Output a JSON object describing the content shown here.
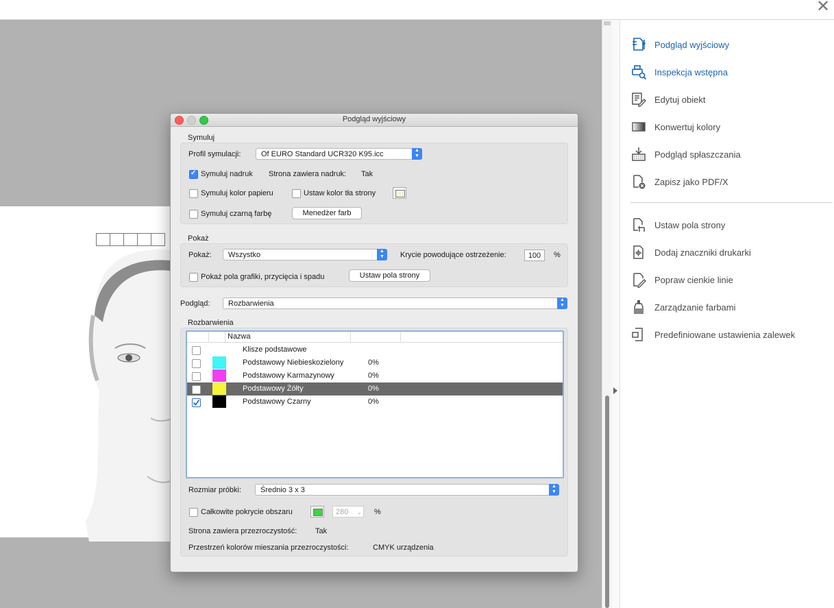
{
  "window": {
    "close_glyph": "✕"
  },
  "right_panel": {
    "items_top": [
      {
        "label": "Podgląd wyjściowy",
        "icon": "output-preview-icon",
        "active": true
      },
      {
        "label": "Inspekcja wstępna",
        "icon": "preflight-icon",
        "active": true
      },
      {
        "label": "Edytuj obiekt",
        "icon": "edit-object-icon",
        "active": false
      },
      {
        "label": "Konwertuj kolory",
        "icon": "convert-colors-icon",
        "active": false
      },
      {
        "label": "Podgląd spłaszczania",
        "icon": "flattener-preview-icon",
        "active": false
      },
      {
        "label": "Zapisz jako PDF/X",
        "icon": "save-pdfx-icon",
        "active": false
      }
    ],
    "items_bottom": [
      {
        "label": "Ustaw pola strony",
        "icon": "set-page-boxes-icon"
      },
      {
        "label": "Dodaj znaczniki drukarki",
        "icon": "printer-marks-icon"
      },
      {
        "label": "Popraw cienkie linie",
        "icon": "fix-hairlines-icon"
      },
      {
        "label": "Zarządzanie farbami",
        "icon": "ink-manager-icon"
      },
      {
        "label": "Predefiniowane ustawienia zalewek",
        "icon": "trap-presets-icon"
      }
    ],
    "accent_color": "#1c64b4"
  },
  "dialog": {
    "title": "Podgląd wyjściowy",
    "simulate": {
      "group_label": "Symuluj",
      "profile_label": "Profil symulacji:",
      "profile_value": "Of  EURO Standard UCR320 K95.icc",
      "simulate_overprint_label": "Symuluj nadruk",
      "simulate_overprint_checked": true,
      "page_has_overprint_label": "Strona zawiera nadruk:",
      "page_has_overprint_value": "Tak",
      "simulate_paper_label": "Symuluj kolor papieru",
      "set_page_bg_label": "Ustaw kolor tła strony",
      "simulate_black_label": "Symuluj czarną farbę",
      "ink_manager_button": "Menedżer farb"
    },
    "show": {
      "group_label": "Pokaż",
      "show_label": "Pokaż:",
      "show_value": "Wszystko",
      "coverage_label": "Krycie powodujące ostrzeżenie:",
      "coverage_value": "100",
      "coverage_unit": "%",
      "show_boxes_label": "Pokaż pola grafiki, przycięcia i spadu",
      "set_page_boxes_button": "Ustaw pola strony"
    },
    "preview": {
      "label": "Podgląd:",
      "value": "Rozbarwienia"
    },
    "separations": {
      "group_label": "Rozbarwienia",
      "column_name": "Nazwa",
      "rows": [
        {
          "name": "Klisze podstawowe",
          "percent": "",
          "color": "",
          "checked": false,
          "selected": false
        },
        {
          "name": "Podstawowy Niebieskozielony",
          "percent": "0%",
          "color": "#3ff6f6",
          "checked": false,
          "selected": false
        },
        {
          "name": "Podstawowy Karmazynowy",
          "percent": "0%",
          "color": "#f23ef2",
          "checked": false,
          "selected": false
        },
        {
          "name": "Podstawowy Żółty",
          "percent": "0%",
          "color": "#f7f53a",
          "checked": false,
          "selected": true
        },
        {
          "name": "Podstawowy Czarny",
          "percent": "0%",
          "color": "#000000",
          "checked": true,
          "selected": false
        }
      ],
      "sample_size_label": "Rozmiar próbki:",
      "sample_size_value": "Średnio 3 x 3",
      "total_area_label": "Całkowite pokrycie obszaru",
      "total_area_color": "#3fd43f",
      "total_area_value": "280",
      "total_area_unit": "%",
      "transparency_label": "Strona zawiera przezroczystość:",
      "transparency_value": "Tak",
      "blend_space_label": "Przestrzeń kolorów mieszania przezroczystości:",
      "blend_space_value": "CMYK urządzenia"
    }
  }
}
